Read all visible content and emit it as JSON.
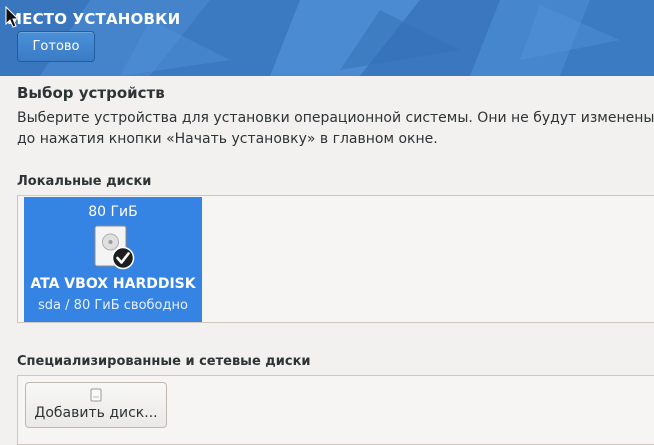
{
  "header": {
    "title": "МЕСТО УСТАНОВКИ",
    "done_label": "Готово"
  },
  "device_selection": {
    "title": "Выбор устройств",
    "description": "Выберите устройства для установки операционной системы. Они не будут изменены до нажатия кнопки «Начать установку» в главном окне."
  },
  "local_disks": {
    "label": "Локальные диски",
    "disks": [
      {
        "size": "80 ГиБ",
        "name": "ATA VBOX HARDDISK",
        "info": "sda  /  80 ГиБ свободно",
        "selected": true,
        "icon": "harddisk-icon",
        "check_icon": "checkmark-icon"
      }
    ]
  },
  "specialized_disks": {
    "label": "Специализированные и сетевые диски",
    "add_button_label": "Добавить диск...",
    "add_button_icon": "disk-add-icon"
  },
  "colors": {
    "header_bg": "#3d7cc4",
    "selected_disk": "#3584e4",
    "window_bg": "#f2f1f0"
  }
}
